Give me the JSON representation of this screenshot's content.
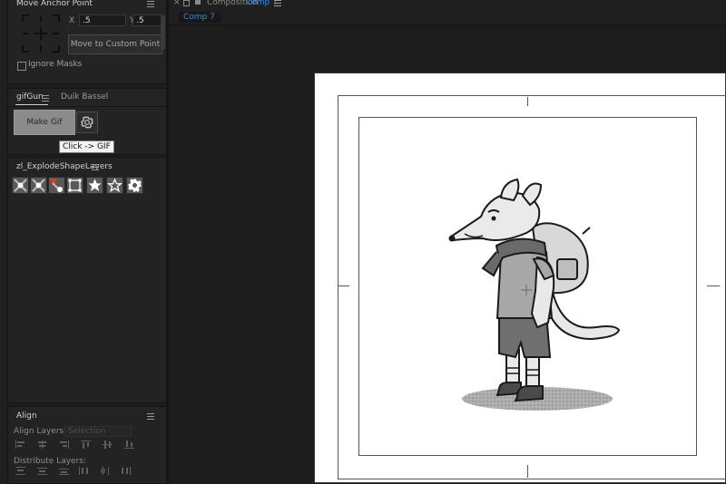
{
  "anchor_panel": {
    "title": "Move Anchor Point",
    "x_label": "X",
    "x_value": ".5",
    "y_label": "Y",
    "y_value": ".5",
    "custom_point_button": "Move to Custom Point",
    "ignore_masks_label": "Ignore Masks"
  },
  "gifgun_panel": {
    "tabs": [
      "gifGun",
      "Duik Bassel"
    ],
    "make_gif_button": "Make Gif",
    "tooltip": "Click -> GIF"
  },
  "explode_panel": {
    "title": "zl_ExplodeShapeLayers",
    "tools": [
      "explode-all-icon",
      "explode-selected-icon",
      "explode-mask-icon",
      "bounding-box-icon",
      "star-filled-icon",
      "star-outline-icon",
      "gear-icon"
    ]
  },
  "align_panel": {
    "title": "Align",
    "align_layers_to_label": "Align Layers to:",
    "align_layers_to_value": "Selection",
    "distribute_label": "Distribute Layers:"
  },
  "composition": {
    "tab_prefix": "Composition",
    "tab_name": "Comp 7",
    "sub_tab": "Comp 7"
  },
  "colors": {
    "accent_blue": "#2d8ceb",
    "panel_bg": "#232323",
    "canvas_white": "#ffffff"
  }
}
